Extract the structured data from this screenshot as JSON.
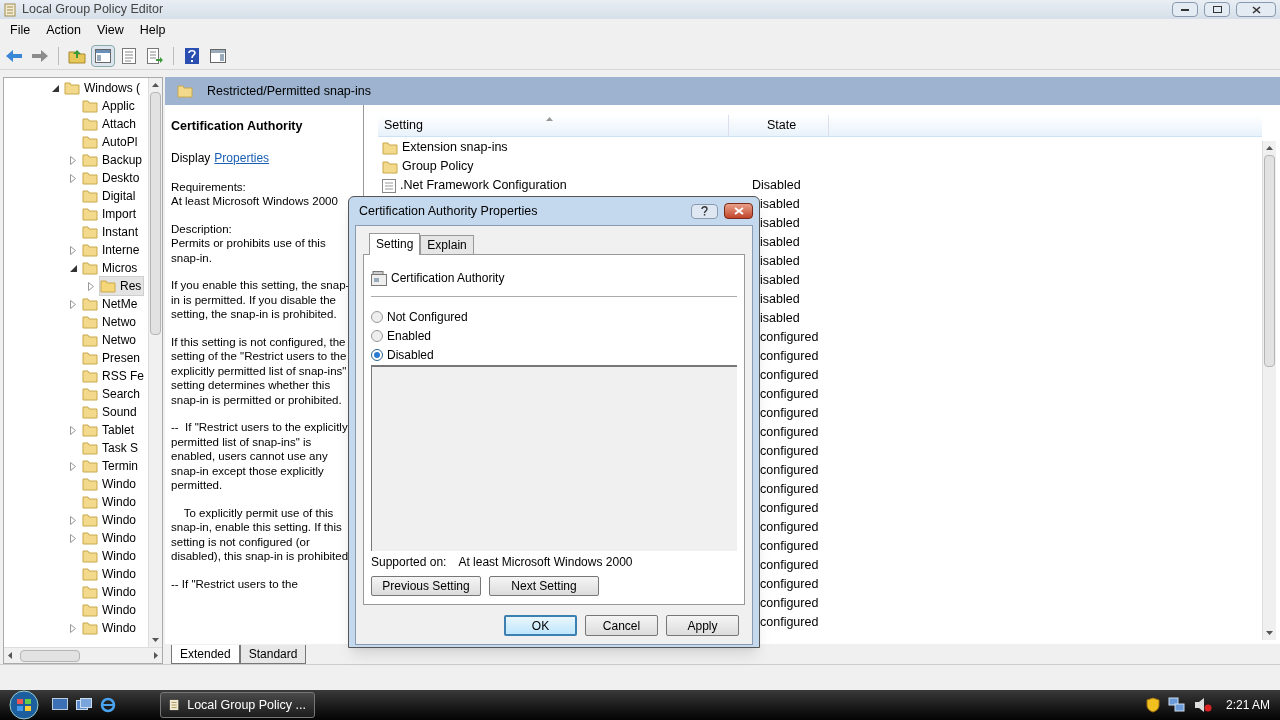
{
  "window": {
    "title": "Local Group Policy Editor"
  },
  "menu": [
    "File",
    "Action",
    "View",
    "Help"
  ],
  "toolbar": [
    {
      "kind": "back",
      "pressed": false
    },
    {
      "kind": "forward",
      "pressed": false
    },
    {
      "kind": "up",
      "pressed": false
    },
    {
      "kind": "tree",
      "pressed": true
    },
    {
      "kind": "properties",
      "pressed": false
    },
    {
      "kind": "export",
      "pressed": false
    },
    {
      "kind": "help",
      "pressed": false
    },
    {
      "kind": "pane",
      "pressed": false
    }
  ],
  "tree": [
    {
      "label": "Windows (",
      "expanded": true,
      "selected": false,
      "children": [
        {
          "label": "Applic",
          "selected": false
        },
        {
          "label": "Attach",
          "selected": false
        },
        {
          "label": "AutoPl",
          "selected": false
        },
        {
          "label": "Backup",
          "expanded": false,
          "selected": false
        },
        {
          "label": "Deskto",
          "expanded": false,
          "selected": false
        },
        {
          "label": "Digital",
          "selected": false
        },
        {
          "label": "Import",
          "selected": false
        },
        {
          "label": "Instant",
          "selected": false
        },
        {
          "label": "Interne",
          "expanded": false,
          "selected": false
        },
        {
          "label": "Micros",
          "expanded": true,
          "selected": false,
          "children": [
            {
              "label": "Res",
              "expanded": false,
              "selected": true
            }
          ]
        },
        {
          "label": "NetMe",
          "expanded": false,
          "selected": false
        },
        {
          "label": "Netwo",
          "selected": false
        },
        {
          "label": "Netwo",
          "selected": false
        },
        {
          "label": "Presen",
          "selected": false
        },
        {
          "label": "RSS Fe",
          "selected": false
        },
        {
          "label": "Search",
          "selected": false
        },
        {
          "label": "Sound",
          "selected": false
        },
        {
          "label": "Tablet",
          "expanded": false,
          "selected": false
        },
        {
          "label": "Task S",
          "selected": false
        },
        {
          "label": "Termin",
          "expanded": false,
          "selected": false
        },
        {
          "label": "Windo",
          "selected": false
        },
        {
          "label": "Windo",
          "selected": false
        },
        {
          "label": "Windo",
          "expanded": false,
          "selected": false
        },
        {
          "label": "Windo",
          "expanded": false,
          "selected": false
        },
        {
          "label": "Windo",
          "selected": false
        },
        {
          "label": "Windo",
          "selected": false
        },
        {
          "label": "Windo",
          "selected": false
        },
        {
          "label": "Windo",
          "selected": false
        },
        {
          "label": "Windo",
          "expanded": false,
          "selected": false
        }
      ]
    }
  ],
  "details": {
    "header": "Restricted/Permitted snap-ins",
    "title": "Certification Authority",
    "display_label": "Display",
    "display_link": "Properties",
    "paragraphs": [
      "Requirements:\nAt least Microsoft Windows 2000",
      "Description:\nPermits or prohibits use of this snap-in.",
      "If you enable this setting, the snap-in is permitted. If you disable the setting, the snap-in is prohibited.",
      "If this setting is not configured, the setting of the \"Restrict users to the explicitly permitted list of snap-ins\" setting determines whether this snap-in is permitted or prohibited.",
      "--  If \"Restrict users to the explicitly permitted list of snap-ins\" is enabled, users cannot use any snap-in except those explicitly permitted.",
      "    To explicitly permit use of this snap-in, enable this setting. If this setting is not configured (or disabled), this snap-in is prohibited.",
      "-- If \"Restrict users to the"
    ]
  },
  "list": {
    "columns": [
      "Setting",
      "State"
    ],
    "rows": [
      {
        "kind": "folder",
        "name": "Extension snap-ins"
      },
      {
        "kind": "folder",
        "name": "Group Policy"
      },
      {
        "kind": "setting",
        "name": ".Net Framework Configuration",
        "state": "Disabled"
      },
      {
        "state": "isabled"
      },
      {
        "state": "isabled"
      },
      {
        "state": "isabled"
      },
      {
        "state": "isabled"
      },
      {
        "state": "isabled"
      },
      {
        "state": "isabled"
      },
      {
        "state": "isabled"
      },
      {
        "state": "configured"
      },
      {
        "state": "configured"
      },
      {
        "state": "configured"
      },
      {
        "state": "configured"
      },
      {
        "state": "configured"
      },
      {
        "state": "configured"
      },
      {
        "state": "configured"
      },
      {
        "state": "configured"
      },
      {
        "state": "configured"
      },
      {
        "state": "configured"
      },
      {
        "state": "configured"
      },
      {
        "state": "configured"
      },
      {
        "state": "configured"
      },
      {
        "state": "configured"
      },
      {
        "state": "configured"
      },
      {
        "state": "configured"
      }
    ]
  },
  "view_tabs": [
    {
      "label": "Extended",
      "selected": true
    },
    {
      "label": "Standard",
      "selected": false
    }
  ],
  "dialog": {
    "title": "Certification Authority Properties",
    "tabs": [
      {
        "label": "Setting",
        "selected": true
      },
      {
        "label": "Explain",
        "selected": false
      }
    ],
    "policy_name": "Certification Authority",
    "options": [
      {
        "label": "Not Configured",
        "selected": false
      },
      {
        "label": "Enabled",
        "selected": false
      },
      {
        "label": "Disabled",
        "selected": true
      }
    ],
    "supported_label": "Supported on:",
    "supported_value": "At least Microsoft Windows 2000",
    "nav_buttons": [
      "Previous Setting",
      "Next Setting"
    ],
    "buttons": [
      {
        "label": "OK",
        "default": true
      },
      {
        "label": "Cancel",
        "default": false
      },
      {
        "label": "Apply",
        "default": false
      }
    ]
  },
  "taskbar": {
    "task": "Local Group Policy ...",
    "clock": "2:21 AM"
  }
}
